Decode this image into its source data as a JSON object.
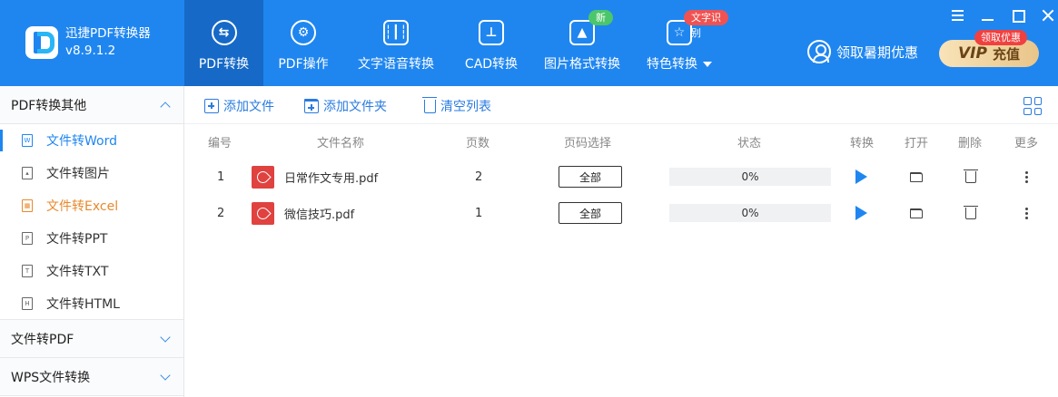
{
  "app": {
    "name": "迅捷PDF转换器",
    "version": "v8.9.1.2"
  },
  "nav": {
    "items": [
      {
        "label": "PDF转换",
        "icon": "pdf-convert-icon",
        "active": true
      },
      {
        "label": "PDF操作",
        "icon": "pdf-operate-icon"
      },
      {
        "label": "文字语音转换",
        "icon": "voice-wave-icon"
      },
      {
        "label": "CAD转换",
        "icon": "cad-icon"
      },
      {
        "label": "图片格式转换",
        "icon": "image-icon",
        "badge": "新"
      },
      {
        "label": "特色转换",
        "icon": "special-convert-icon",
        "badge": "文字识别"
      }
    ]
  },
  "promo": {
    "label": "领取暑期优惠"
  },
  "vip": {
    "tag": "领取优惠",
    "brand": "VIP",
    "label": "充值"
  },
  "sidebar": {
    "sections": [
      {
        "label": "PDF转换其他",
        "expanded": true
      },
      {
        "label": "文件转PDF",
        "expanded": false
      },
      {
        "label": "WPS文件转换",
        "expanded": false
      }
    ],
    "items": [
      {
        "label": "文件转Word",
        "icon_letter": "W",
        "state": "active"
      },
      {
        "label": "文件转图片",
        "icon_letter": "",
        "state": ""
      },
      {
        "label": "文件转Excel",
        "icon_letter": "",
        "state": "highlight"
      },
      {
        "label": "文件转PPT",
        "icon_letter": "P",
        "state": ""
      },
      {
        "label": "文件转TXT",
        "icon_letter": "T",
        "state": ""
      },
      {
        "label": "文件转HTML",
        "icon_letter": "H",
        "state": ""
      }
    ]
  },
  "toolbar": {
    "add_file": "添加文件",
    "add_folder": "添加文件夹",
    "clear_list": "清空列表"
  },
  "table": {
    "headers": {
      "no": "编号",
      "name": "文件名称",
      "pages": "页数",
      "range": "页码选择",
      "status": "状态",
      "convert": "转换",
      "open": "打开",
      "delete": "删除",
      "more": "更多"
    },
    "rows": [
      {
        "no": "1",
        "name": "日常作文专用.pdf",
        "pages": "2",
        "range": "全部",
        "progress": "0%"
      },
      {
        "no": "2",
        "name": "微信技巧.pdf",
        "pages": "1",
        "range": "全部",
        "progress": "0%"
      }
    ]
  },
  "colors": {
    "primary": "#1f86f0",
    "nav_active": "#1669c7",
    "badge_new": "#4cc66a",
    "badge_ocr": "#f05252",
    "highlight": "#e8892c",
    "pdf_red": "#e0423f"
  }
}
